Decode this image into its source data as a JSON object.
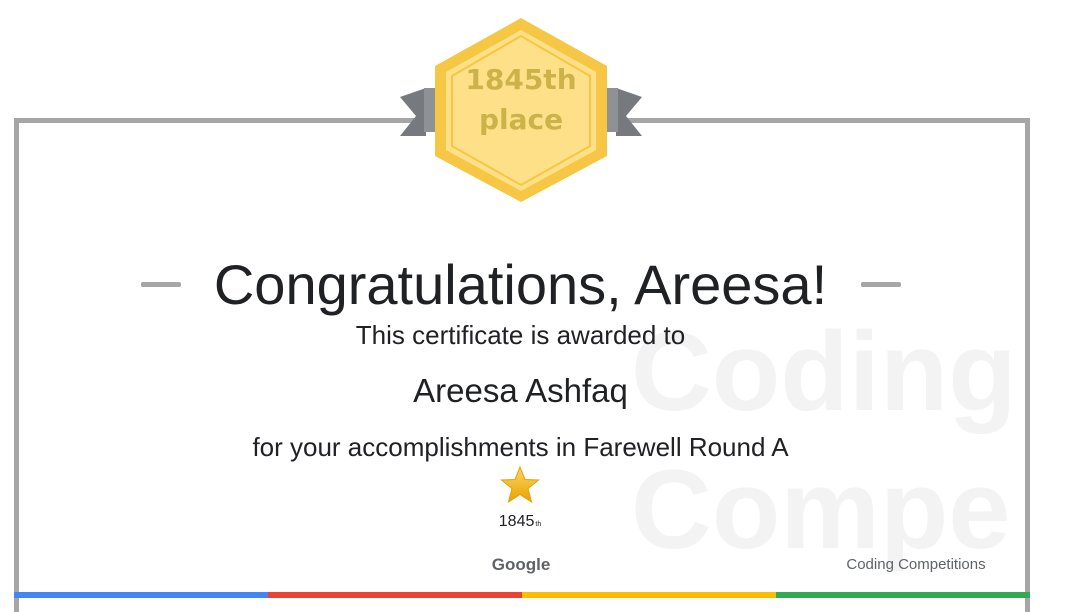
{
  "badge": {
    "line1": "1845th",
    "line2": "place"
  },
  "certificate": {
    "title": "Congratulations, Areesa!",
    "awarded_text": "This certificate is awarded to",
    "recipient_name": "Areesa Ashfaq",
    "accomplishment": "for your accomplishments in Farewell Round A",
    "rank_number": "1845",
    "rank_suffix": "th"
  },
  "watermark": {
    "line1": "Coding",
    "line2": "Compe"
  },
  "footer": {
    "google_label": "Google",
    "product_label": "Coding Competitions"
  },
  "colors": {
    "badge_fill": "#fde087",
    "badge_border": "#f6c744",
    "badge_text": "#cbb34a",
    "ribbon": "#8e9196",
    "frame": "#a6a6a6",
    "star": "#f6b715",
    "stripe_blue": "#4285f4",
    "stripe_red": "#ea4335",
    "stripe_yellow": "#fbbc04",
    "stripe_green": "#34a853"
  },
  "icons": {
    "badge": "hexagon-ribbon-badge-icon",
    "rank": "star-icon"
  }
}
